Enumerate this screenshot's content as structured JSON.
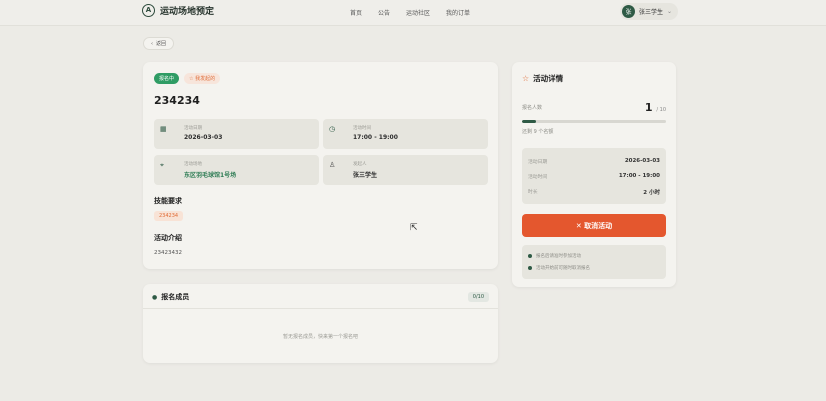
{
  "header": {
    "logo_glyph": "A",
    "brand": "运动场地预定",
    "nav": [
      "首页",
      "公告",
      "运动社区",
      "我的订单"
    ],
    "user": {
      "avatar": "张",
      "name": "张三学生"
    }
  },
  "back_label": "返回",
  "activity": {
    "status_badge": "报名中",
    "tag_badge": "☆ 我发起的",
    "title": "234234",
    "info": {
      "date_label": "活动日期",
      "date_value": "2026-03-03",
      "time_label": "活动时间",
      "time_value": "17:00 - 19:00",
      "venue_label": "活动场地",
      "venue_value": "东区羽毛球馆1号场",
      "organizer_label": "发起人",
      "organizer_value": "张三学生"
    },
    "skill_title": "技能要求",
    "skill_tag": "234234",
    "intro_title": "活动介绍",
    "intro_text": "23423432"
  },
  "members": {
    "title": "报名成员",
    "count": "0/10",
    "empty_text": "暂无报名成员，快来第一个报名吧"
  },
  "side": {
    "title": "活动详情",
    "enroll_label": "报名人数",
    "enroll_current": "1",
    "enroll_max": "/ 10",
    "progress_ratio": 0.1,
    "remain_text": "还剩 9 个名额",
    "summary": [
      {
        "label": "活动日期",
        "value": "2026-03-03"
      },
      {
        "label": "活动时间",
        "value": "17:00 - 19:00"
      },
      {
        "label": "时长",
        "value": "2 小时"
      }
    ],
    "cancel_label": "✕ 取消活动",
    "notes": [
      "报名后请准时参加活动",
      "活动开始前可随时取消报名"
    ]
  },
  "colors": {
    "accent_green": "#2e5a45",
    "status_green": "#2f9c64",
    "danger_orange": "#e4572e"
  }
}
